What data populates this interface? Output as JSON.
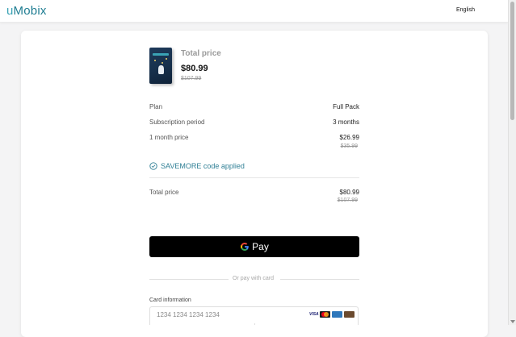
{
  "header": {
    "logo_prefix": "u",
    "logo_rest": "Mobix",
    "language": "English"
  },
  "summary": {
    "total_label": "Total price",
    "total_price": "$80.99",
    "total_old": "$107.99"
  },
  "details": [
    {
      "label": "Plan",
      "value": "Full Pack",
      "old": ""
    },
    {
      "label": "Subscription period",
      "value": "3 months",
      "old": ""
    },
    {
      "label": "1 month price",
      "value": "$26.99",
      "old": "$35.99"
    }
  ],
  "promo": {
    "text": "SAVEMORE code applied"
  },
  "total": {
    "label": "Total price",
    "value": "$80.99",
    "old": "$107.99"
  },
  "gpay": {
    "label": "Pay"
  },
  "separator": "Or pay with card",
  "card": {
    "label": "Card information",
    "placeholder": "1234 1234 1234 1234",
    "brands": [
      "VISA",
      "mastercard-icon",
      "amex-icon",
      "discover-icon"
    ]
  },
  "colors": {
    "brand": "#1f7d92",
    "promo": "#2f7f95",
    "button": "#000000"
  }
}
